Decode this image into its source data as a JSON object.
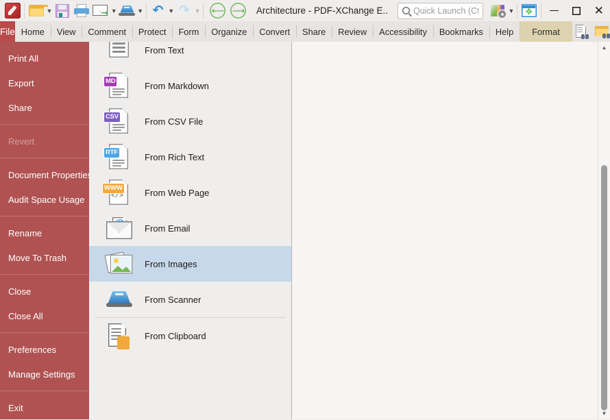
{
  "window": {
    "title": "Architecture - PDF-XChange E..",
    "controls": {
      "minimize": "minimize-button",
      "maximize": "maximize-button",
      "close": "close-button"
    }
  },
  "quick_access_toolbar": {
    "items": [
      {
        "name": "app-logo",
        "label": "PDF-XChange Editor"
      },
      {
        "name": "open-folder",
        "label": "Open"
      },
      {
        "name": "save",
        "label": "Save"
      },
      {
        "name": "print",
        "label": "Print"
      },
      {
        "name": "email",
        "label": "Email"
      },
      {
        "name": "scan",
        "label": "Scan"
      },
      {
        "name": "undo",
        "label": "Undo"
      },
      {
        "name": "redo",
        "label": "Redo"
      }
    ],
    "nav_back": "Back",
    "nav_forward": "Forward"
  },
  "search": {
    "placeholder": "Quick Launch (Ctrl+.)",
    "value": ""
  },
  "ribbon": {
    "file_tab": "File",
    "tabs": [
      "Home",
      "View",
      "Comment",
      "Protect",
      "Form",
      "Organize",
      "Convert",
      "Share",
      "Review",
      "Accessibility",
      "Bookmarks",
      "Help"
    ],
    "contextual_tab": "Format",
    "right_tools": [
      "document-search-icon",
      "folder-search-icon",
      "collapse-ribbon-icon"
    ]
  },
  "sidebar": {
    "groups": [
      {
        "items": [
          {
            "label": "Print All",
            "enabled": true
          },
          {
            "label": "Export",
            "enabled": true
          },
          {
            "label": "Share",
            "enabled": true
          }
        ]
      },
      {
        "items": [
          {
            "label": "Revert",
            "enabled": false
          }
        ]
      },
      {
        "items": [
          {
            "label": "Document Properties",
            "enabled": true
          },
          {
            "label": "Audit Space Usage",
            "enabled": true
          }
        ]
      },
      {
        "items": [
          {
            "label": "Rename",
            "enabled": true
          },
          {
            "label": "Move To Trash",
            "enabled": true
          }
        ]
      },
      {
        "items": [
          {
            "label": "Close",
            "enabled": true
          },
          {
            "label": "Close All",
            "enabled": true
          }
        ]
      },
      {
        "items": [
          {
            "label": "Preferences",
            "enabled": true
          },
          {
            "label": "Manage Settings",
            "enabled": true
          }
        ]
      },
      {
        "items": [
          {
            "label": "Exit",
            "enabled": true
          }
        ]
      }
    ]
  },
  "new_document_list": {
    "items": [
      {
        "label": "From Text",
        "icon": "text-document-icon",
        "selected": false,
        "clipped": true
      },
      {
        "label": "From Markdown",
        "icon": "markdown-document-icon",
        "badge": "MD",
        "selected": false
      },
      {
        "label": "From CSV File",
        "icon": "csv-document-icon",
        "badge": "CSV",
        "selected": false
      },
      {
        "label": "From Rich Text",
        "icon": "rtf-document-icon",
        "badge": "RTF",
        "selected": false
      },
      {
        "label": "From Web Page",
        "icon": "web-page-document-icon",
        "badge": "WWW",
        "code": "</>",
        "selected": false
      },
      {
        "label": "From Email",
        "icon": "email-icon",
        "selected": false
      },
      {
        "label": "From Images",
        "icon": "images-icon",
        "selected": true
      },
      {
        "label": "From Scanner",
        "icon": "scanner-icon",
        "selected": false
      },
      {
        "label": "From Clipboard",
        "icon": "clipboard-icon",
        "selected": false,
        "separator_before": true
      }
    ]
  },
  "colors": {
    "file_tab_red": "#b94a4a",
    "sidebar_red": "#b05252",
    "selection_blue": "#c7d8ea",
    "contextual_tab": "#ded3b0",
    "window_bg": "#f0eeec"
  }
}
